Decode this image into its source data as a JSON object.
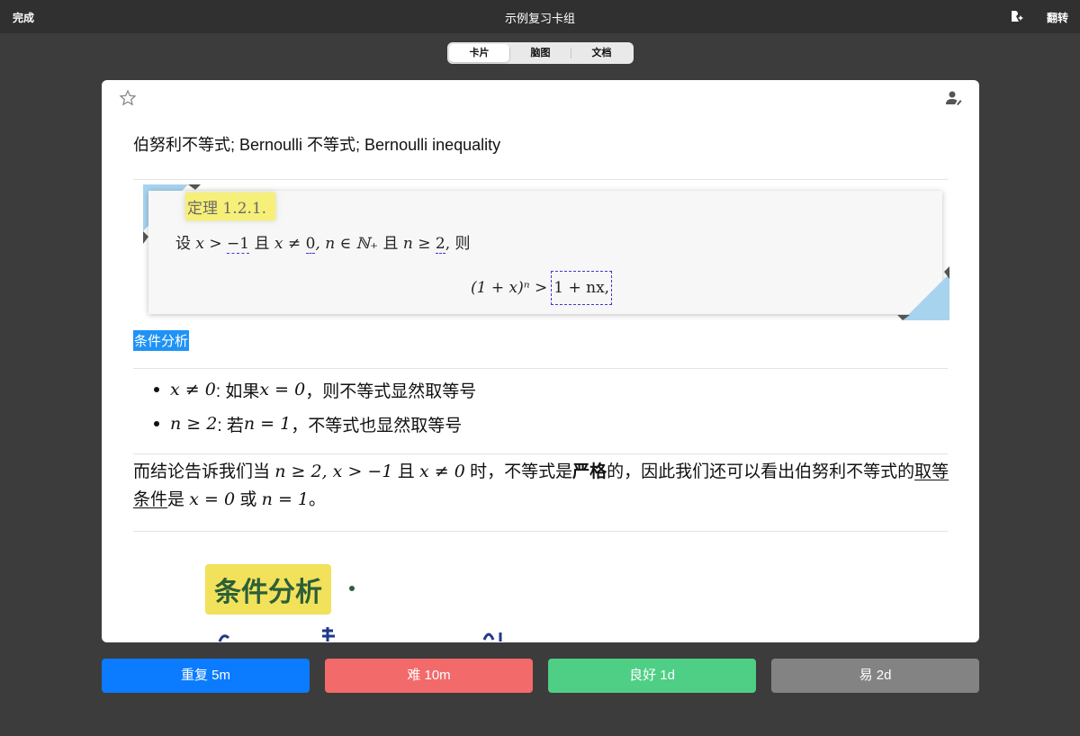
{
  "topbar": {
    "done_label": "完成",
    "title": "示例复习卡组",
    "flip_label": "翻转",
    "ai_icon": "pencil-sparkle-icon"
  },
  "tabs": [
    {
      "label": "卡片",
      "active": true
    },
    {
      "label": "脑图",
      "active": false
    },
    {
      "label": "文档",
      "active": false
    }
  ],
  "card": {
    "front_text": "伯努利不等式; Bernoulli 不等式; Bernoulli inequality",
    "theorem": {
      "title": "定理 1.2.1.",
      "premise": {
        "p1": "设 ",
        "m1": "x > ",
        "m2": "−1",
        "p2": " 且 ",
        "m3": "x ≠ ",
        "m4": "0",
        "m5": ", n ∈ ℕ₊",
        "p3": " 且 ",
        "m6": "n ≥ ",
        "m7": "2",
        "p4": ", 则"
      },
      "equation_left": "(1 + x)ⁿ >",
      "equation_right": "1 + nx,"
    },
    "section_label": "条件分析",
    "bullets": [
      {
        "math": "x ≠ 0",
        "text": ": 如果 ",
        "math2": "x = 0",
        "text2": "，则不等式显然取等号"
      },
      {
        "math": "n ≥ 2",
        "text": ": 若 ",
        "math2": "n = 1",
        "text2": "，不等式也显然取等号"
      }
    ],
    "paragraph": {
      "t1": "而结论告诉我们当 ",
      "m1": "n ≥ 2, x > −1",
      "t2": " 且 ",
      "m2": "x ≠ 0",
      "t3": " 时，不等式是",
      "bold": "严格",
      "t4": "的，因此我们还可以看出伯努利不等式的",
      "underline": "取等条件",
      "t5": "是 ",
      "m3": "x = 0",
      "t6": " 或 ",
      "m4": "n = 1",
      "t7": "。"
    },
    "handwritten_label": "条件分析"
  },
  "buttons": [
    {
      "label": "重复 5m",
      "color": "#0b7bff"
    },
    {
      "label": "难 10m",
      "color": "#f36a6a"
    },
    {
      "label": "良好 1d",
      "color": "#4fcf85"
    },
    {
      "label": "易 2d",
      "color": "#838383"
    }
  ]
}
